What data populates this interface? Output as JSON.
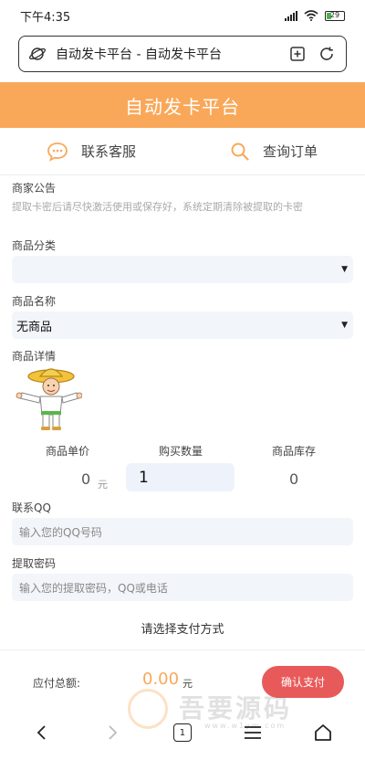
{
  "status": {
    "time": "下午4:35",
    "battery": "29",
    "battery_level": 0.29
  },
  "browser": {
    "address": "自动发卡平台 - 自动发卡平台",
    "tab_count": "1"
  },
  "header": {
    "title": "自动发卡平台"
  },
  "quicknav": {
    "contact": "联系客服",
    "query": "查询订单"
  },
  "notice": {
    "title": "商家公告",
    "text": "提取卡密后请尽快激活使用或保存好，系统定期清除被提取的卡密"
  },
  "category": {
    "label": "商品分类",
    "value": ""
  },
  "product": {
    "label": "商品名称",
    "value": "无商品"
  },
  "details": {
    "label": "商品详情"
  },
  "stats": {
    "price_label": "商品单价",
    "price_value": "0",
    "price_unit": "元",
    "qty_label": "购买数量",
    "qty_value": "1",
    "stock_label": "商品库存",
    "stock_value": "0"
  },
  "contact_qq": {
    "label": "联系QQ",
    "placeholder": "输入您的QQ号码"
  },
  "password": {
    "label": "提取密码",
    "placeholder": "输入您的提取密码，QQ或电话"
  },
  "payment": {
    "title": "请选择支付方式"
  },
  "footer": {
    "total_label": "应付总额:",
    "total_value": "0.00",
    "total_unit": "元",
    "pay_button": "确认支付"
  },
  "watermark": {
    "text": "吾要源码",
    "url": "www.w1ym.com"
  },
  "colors": {
    "accent": "#f9a85a",
    "pay": "#e85a5a",
    "field_bg": "#f2f5fa"
  }
}
